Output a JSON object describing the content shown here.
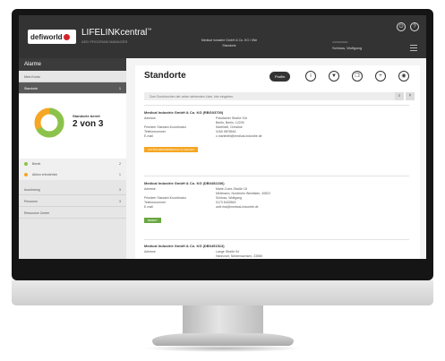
{
  "header": {
    "brand": "defiworld",
    "product": "LIFELINKcentral",
    "product_suffix": "™",
    "product_sub": "AED PROGRAM MANAGER",
    "company_line1": "Medical Industrie GmbH & Co. KG / IWe",
    "company_line2": "Standorte",
    "user_role": "ANWENDER",
    "user_name": "Schloss, Wolfgang",
    "icons": [
      "power-icon",
      "help-icon",
      "menu-icon"
    ]
  },
  "sidebar": {
    "title": "Alarme",
    "items_top": [
      {
        "label": "Mein Konto",
        "count": ""
      },
      {
        "label": "Standorte",
        "count": "1",
        "active": true
      }
    ],
    "status": {
      "label": "Standorte bereit",
      "value": "2 von 3",
      "ready": 2,
      "total": 3
    },
    "legend": [
      {
        "label": "Bereit",
        "count": "2",
        "color": "#8bc34a"
      },
      {
        "label": "Aktion erforderlich",
        "count": "1",
        "color": "#f5a623"
      }
    ],
    "items_bottom": [
      {
        "label": "Ausrüstung",
        "count": "3"
      },
      {
        "label": "Personen",
        "count": "3"
      },
      {
        "label": "Ressource Center",
        "count": ""
      }
    ]
  },
  "main": {
    "title": "Standorte",
    "toolbar": {
      "profile_label": "Profile",
      "icons": [
        "info-icon",
        "filter-icon",
        "copy-icon",
        "add-icon",
        "target-icon"
      ]
    },
    "search": {
      "placeholder": "Zum Durchsuchen der unten stehenden Liste, hier eingeben."
    },
    "entries": [
      {
        "title": "Medical Industrie GmbH & Co. KG (RBG03700)",
        "rows": [
          {
            "key": "Adresse",
            "value": "Potsdamer Straße 31e"
          },
          {
            "key": "",
            "value": "Berlin, Berlin, 12205"
          },
          {
            "key": "Primärer Standort-Koordinator",
            "value": "Martinelli, Christine"
          },
          {
            "key": "Telefonnummer",
            "value": "0160 9876546"
          },
          {
            "key": "E-mail",
            "value": "c.martinelli@medical-industrie.de"
          }
        ],
        "status": "AKTION ERFORDERLICH (1 Zubehör)",
        "status_color": "#f5a623"
      },
      {
        "title": "Medical Industrie GmbH & Co. KG (DB0452236)",
        "rows": [
          {
            "key": "Adresse",
            "value": "Marie-Curie-Straße 18"
          },
          {
            "key": "",
            "value": "Mettmann, Nordrhein Westfalen, 40822"
          },
          {
            "key": "Primärer Standort-Koordinator",
            "value": "Schloss, Wolfgang"
          },
          {
            "key": "Telefonnummer",
            "value": "0173 5432563"
          },
          {
            "key": "E-mail",
            "value": "wolf.risk@medical-industrie.de"
          }
        ],
        "status": "BEREIT",
        "status_color": "#6aa842"
      },
      {
        "title": "Medical Industrie GmbH & Co. KG (DB0451513)",
        "rows": [
          {
            "key": "Adresse",
            "value": "Lange Straße 54"
          },
          {
            "key": "",
            "value": "Hannover, Niedersachsen, 23565"
          }
        ]
      }
    ]
  }
}
